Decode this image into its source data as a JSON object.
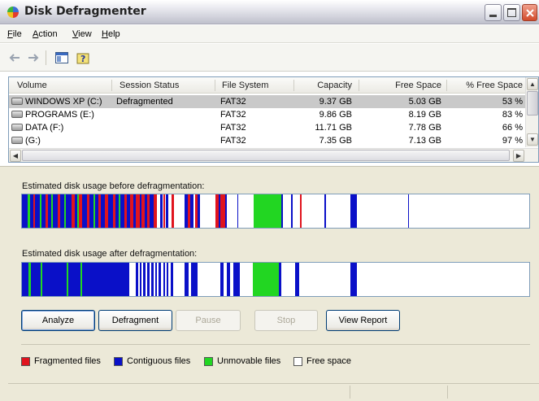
{
  "window": {
    "title": "Disk Defragmenter"
  },
  "menubar": {
    "items": [
      {
        "label": "File",
        "accel": "F",
        "rest": "ile"
      },
      {
        "label": "Action",
        "accel": "A",
        "rest": "ction"
      },
      {
        "label": "View",
        "accel": "V",
        "rest": "iew"
      },
      {
        "label": "Help",
        "accel": "H",
        "rest": "elp"
      }
    ]
  },
  "toolbar": {
    "icons": [
      "back-arrow-icon",
      "forward-arrow-icon",
      "show-hide-tree-icon",
      "help-icon"
    ]
  },
  "volumes": {
    "columns": [
      "Volume",
      "Session Status",
      "File System",
      "Capacity",
      "Free Space",
      "% Free Space"
    ],
    "rows": [
      {
        "volume": "WINDOWS XP (C:)",
        "status": "Defragmented",
        "fs": "FAT32",
        "capacity": "9.37 GB",
        "free": "5.03 GB",
        "pct": "53 %"
      },
      {
        "volume": "PROGRAMS (E:)",
        "status": "",
        "fs": "FAT32",
        "capacity": "9.86 GB",
        "free": "8.19 GB",
        "pct": "83 %"
      },
      {
        "volume": "DATA (F:)",
        "status": "",
        "fs": "FAT32",
        "capacity": "11.71 GB",
        "free": "7.78 GB",
        "pct": "66 %"
      },
      {
        "volume": "(G:)",
        "status": "",
        "fs": "FAT32",
        "capacity": "7.35 GB",
        "free": "7.13 GB",
        "pct": "97 %"
      }
    ],
    "selected_index": 0
  },
  "analysis": {
    "before_label": "Estimated disk usage before defragmentation:",
    "after_label": "Estimated disk usage after defragmentation:"
  },
  "buttons": {
    "analyze": "Analyze",
    "defragment": "Defragment",
    "pause": "Pause",
    "stop": "Stop",
    "view_report": "View Report"
  },
  "legend": {
    "fragmented": {
      "label": "Fragmented files",
      "color": "#e0141e"
    },
    "contiguous": {
      "label": "Contiguous files",
      "color": "#0a10c8"
    },
    "unmovable": {
      "label": "Unmovable files",
      "color": "#22d622"
    },
    "free": {
      "label": "Free space",
      "color": "#ffffff"
    }
  }
}
